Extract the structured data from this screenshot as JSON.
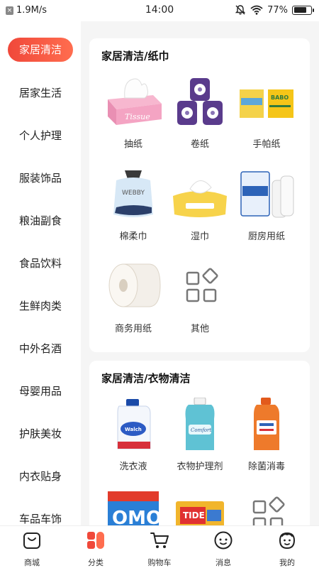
{
  "status_bar": {
    "speed": "1.9M/s",
    "time": "14:00",
    "battery_pct": "77%",
    "battery_level": 0.77
  },
  "sidebar": {
    "items": [
      {
        "label": "家居清洁",
        "active": true
      },
      {
        "label": "居家生活"
      },
      {
        "label": "个人护理"
      },
      {
        "label": "服装饰品"
      },
      {
        "label": "粮油副食"
      },
      {
        "label": "食品饮料"
      },
      {
        "label": "生鲜肉类"
      },
      {
        "label": "中外名酒"
      },
      {
        "label": "母婴用品"
      },
      {
        "label": "护肤美妆"
      },
      {
        "label": "内衣贴身"
      },
      {
        "label": "车品车饰"
      }
    ]
  },
  "sections": [
    {
      "title": "家居清洁/纸巾",
      "products": [
        {
          "label": "抽纸",
          "icon": "tissue-box-icon"
        },
        {
          "label": "卷纸",
          "icon": "toilet-roll-icon"
        },
        {
          "label": "手帕纸",
          "icon": "pocket-tissue-icon"
        },
        {
          "label": "棉柔巾",
          "icon": "cotton-towel-icon"
        },
        {
          "label": "湿巾",
          "icon": "wet-wipes-icon"
        },
        {
          "label": "厨房用纸",
          "icon": "kitchen-paper-icon"
        },
        {
          "label": "商务用纸",
          "icon": "jumbo-roll-icon"
        },
        {
          "label": "其他",
          "icon": "grid-shapes-icon"
        }
      ]
    },
    {
      "title": "家居清洁/衣物清洁",
      "products": [
        {
          "label": "洗衣液",
          "icon": "laundry-detergent-icon"
        },
        {
          "label": "衣物护理剂",
          "icon": "softener-icon"
        },
        {
          "label": "除菌消毒",
          "icon": "disinfectant-icon"
        },
        {
          "label": "",
          "icon": "omo-powder-icon"
        },
        {
          "label": "",
          "icon": "detergent-bag-icon"
        },
        {
          "label": "",
          "icon": "grid-shapes-icon"
        }
      ]
    }
  ],
  "bottom_nav": {
    "items": [
      {
        "label": "商城",
        "icon": "shop-bag-icon"
      },
      {
        "label": "分类",
        "icon": "category-icon",
        "active": true
      },
      {
        "label": "购物车",
        "icon": "cart-icon"
      },
      {
        "label": "消息",
        "icon": "message-icon"
      },
      {
        "label": "我的",
        "icon": "profile-icon"
      }
    ]
  },
  "colors": {
    "accent": "#f0483a",
    "accent_light": "#ff6d4f"
  }
}
